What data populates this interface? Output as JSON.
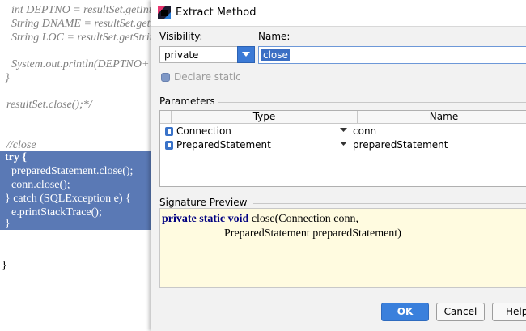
{
  "editor": {
    "lines": [
      "int DEPTNO = resultSet.getInt(",
      "String DNAME = resultSet.getS",
      "String LOC = resultSet.getStrin",
      "System.out.println(DEPTNO+\"",
      "}",
      "resultSet.close();*/",
      "//close"
    ],
    "selected_lines": [
      "try {",
      "preparedStatement.close();",
      "conn.close();",
      "} catch (SQLException e) {",
      "e.printStackTrace();",
      "}"
    ],
    "closing_brace": "}"
  },
  "dialog": {
    "title": "Extract Method",
    "visibility_label": "Visibility:",
    "visibility_value": "private",
    "name_label": "Name:",
    "name_value": "close",
    "declare_static_label": "Declare static",
    "declare_static_checked": true,
    "parameters_label": "Parameters",
    "columns": [
      "Type",
      "Name"
    ],
    "parameters": [
      {
        "type": "Connection",
        "name": "conn"
      },
      {
        "type": "PreparedStatement",
        "name": "preparedStatement"
      }
    ],
    "signature_label": "Signature Preview",
    "signature": {
      "keywords": "private static void",
      "line1_rest": " close(Connection conn,",
      "line2": "PreparedStatement preparedStatement)"
    },
    "buttons": {
      "ok": "OK",
      "cancel": "Cancel",
      "help": "Help"
    }
  },
  "colors": {
    "selection": "#5a79b5",
    "accent": "#3a80dc",
    "preview_bg": "#fffbe0"
  }
}
